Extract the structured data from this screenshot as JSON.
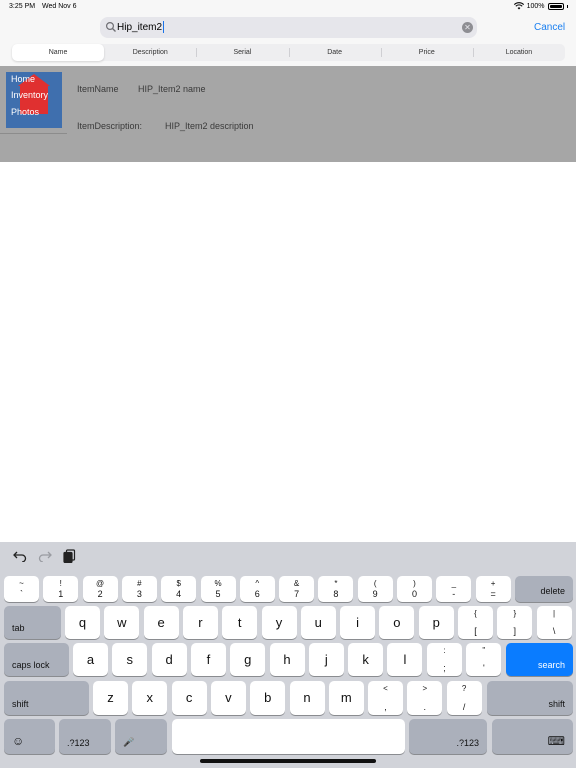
{
  "status": {
    "time": "3:25 PM",
    "date": "Wed Nov 6",
    "battery": "100%"
  },
  "search": {
    "value": "Hip_item2",
    "cancel_label": "Cancel"
  },
  "scope_tabs": [
    {
      "label": "Name"
    },
    {
      "label": "Description"
    },
    {
      "label": "Serial"
    },
    {
      "label": "Date"
    },
    {
      "label": "Price"
    },
    {
      "label": "Location"
    }
  ],
  "result": {
    "thumb": {
      "line1": "Home",
      "line2": "Inventory",
      "line3": "Photos"
    },
    "name_label": "ItemName",
    "name_value": "HIP_Item2 name",
    "desc_label": "ItemDescription:",
    "desc_value": "HIP_Item2 description"
  },
  "keyboard": {
    "number_row": [
      {
        "top": "~",
        "bot": "`"
      },
      {
        "top": "!",
        "bot": "1"
      },
      {
        "top": "@",
        "bot": "2"
      },
      {
        "top": "#",
        "bot": "3"
      },
      {
        "top": "$",
        "bot": "4"
      },
      {
        "top": "%",
        "bot": "5"
      },
      {
        "top": "^",
        "bot": "6"
      },
      {
        "top": "&",
        "bot": "7"
      },
      {
        "top": "*",
        "bot": "8"
      },
      {
        "top": "(",
        "bot": "9"
      },
      {
        "top": ")",
        "bot": "0"
      },
      {
        "top": "_",
        "bot": "-"
      },
      {
        "top": "+",
        "bot": "="
      }
    ],
    "delete_label": "delete",
    "tab_label": "tab",
    "row_q": [
      "q",
      "w",
      "e",
      "r",
      "t",
      "y",
      "u",
      "i",
      "o",
      "p"
    ],
    "row_q_extra": [
      {
        "top": "{",
        "bot": "["
      },
      {
        "top": "}",
        "bot": "]"
      },
      {
        "top": "|",
        "bot": "\\"
      }
    ],
    "caps_label": "caps lock",
    "row_a": [
      "a",
      "s",
      "d",
      "f",
      "g",
      "h",
      "j",
      "k",
      "l"
    ],
    "row_a_extra": [
      {
        "top": ":",
        "bot": ";"
      },
      {
        "top": "\"",
        "bot": "'"
      }
    ],
    "search_label": "search",
    "shift_label": "shift",
    "row_z": [
      "z",
      "x",
      "c",
      "v",
      "b",
      "n",
      "m"
    ],
    "row_z_extra": [
      {
        "top": "<",
        "bot": ","
      },
      {
        "top": ">",
        "bot": "."
      },
      {
        "top": "?",
        "bot": "/"
      }
    ],
    "numbers_label": ".?123"
  }
}
